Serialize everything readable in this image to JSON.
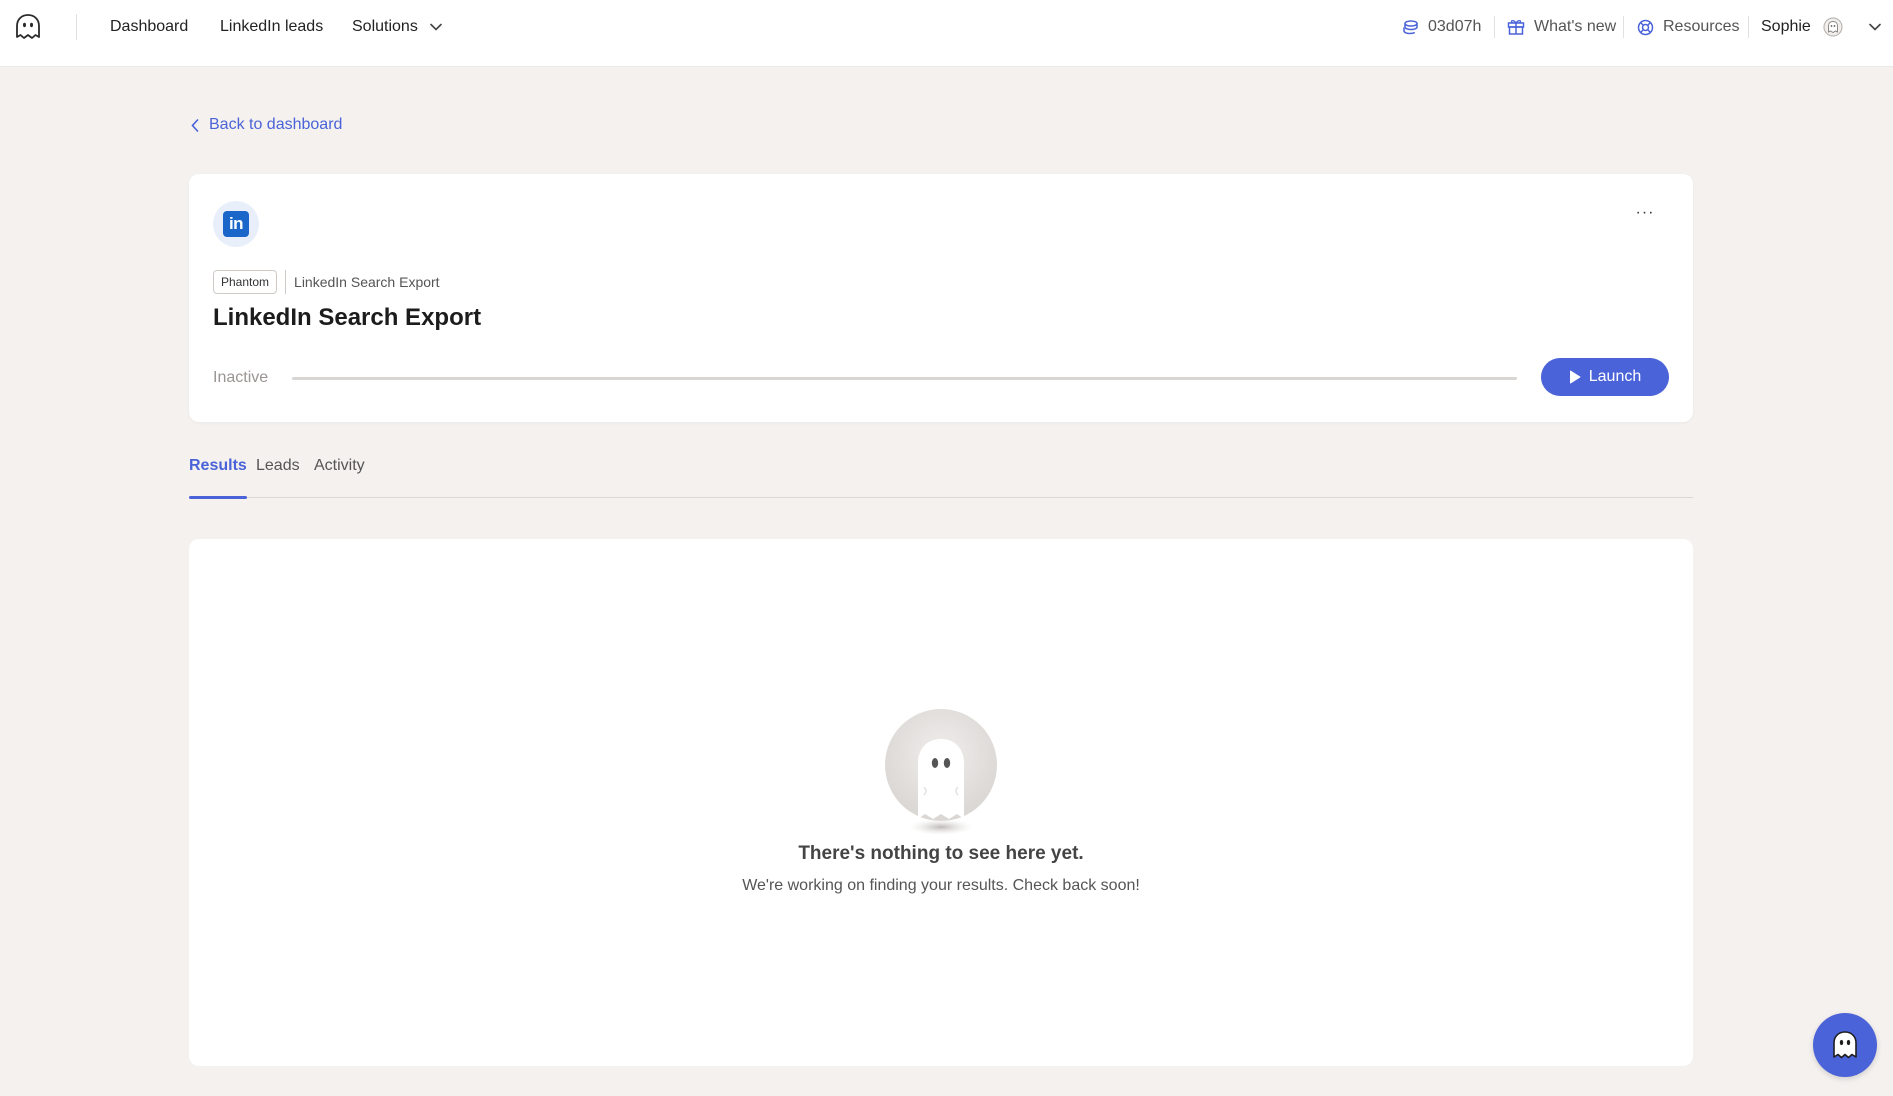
{
  "nav": {
    "items": [
      {
        "label": "Dashboard"
      },
      {
        "label": "LinkedIn leads"
      },
      {
        "label": "Solutions"
      }
    ],
    "time_remaining": "03d07h",
    "whats_new": "What's new",
    "resources": "Resources",
    "user_name": "Sophie"
  },
  "back_link": "Back to dashboard",
  "phantom": {
    "chip": "Phantom",
    "type_label": "LinkedIn Search Export",
    "title": "LinkedIn Search Export",
    "status": "Inactive",
    "progress": 0,
    "launch_label": "Launch",
    "more_label": "···"
  },
  "tabs": [
    {
      "label": "Results",
      "active": true
    },
    {
      "label": "Leads",
      "active": false
    },
    {
      "label": "Activity",
      "active": false
    }
  ],
  "results": {
    "empty_title": "There's nothing to see here yet.",
    "empty_subtitle": "We're working on finding your results. Check back soon!"
  },
  "colors": {
    "accent": "#4a63d8",
    "linkedin": "#1b66c9",
    "background": "#f4f1ef"
  },
  "icons": [
    "ghost-logo-icon",
    "chevron-down-icon",
    "credits-icon",
    "gift-icon",
    "lifebuoy-icon",
    "avatar-ghost-icon",
    "chevron-left-icon",
    "linkedin-icon",
    "more-icon",
    "play-icon",
    "ghost-illustration-icon",
    "chat-ghost-icon"
  ]
}
